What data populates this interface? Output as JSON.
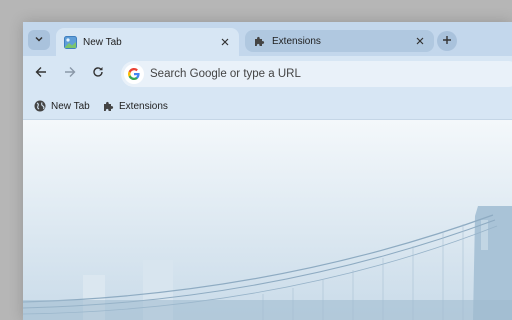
{
  "tabs": [
    {
      "label": "New Tab",
      "icon": "new-tab-page-icon",
      "active": true
    },
    {
      "label": "Extensions",
      "icon": "puzzle-icon",
      "active": false
    }
  ],
  "omnibox": {
    "placeholder": "Search Google or type a URL"
  },
  "bookmarks": [
    {
      "label": "New Tab",
      "icon": "globe-icon"
    },
    {
      "label": "Extensions",
      "icon": "puzzle-icon"
    }
  ],
  "colors": {
    "frame": "#c3d7ec",
    "toolbar": "#d7e6f4",
    "omnibox": "#e9f1f9",
    "backdrop": "#b6b6b6"
  },
  "content": {
    "background_image": "foggy-bridge-photo"
  }
}
